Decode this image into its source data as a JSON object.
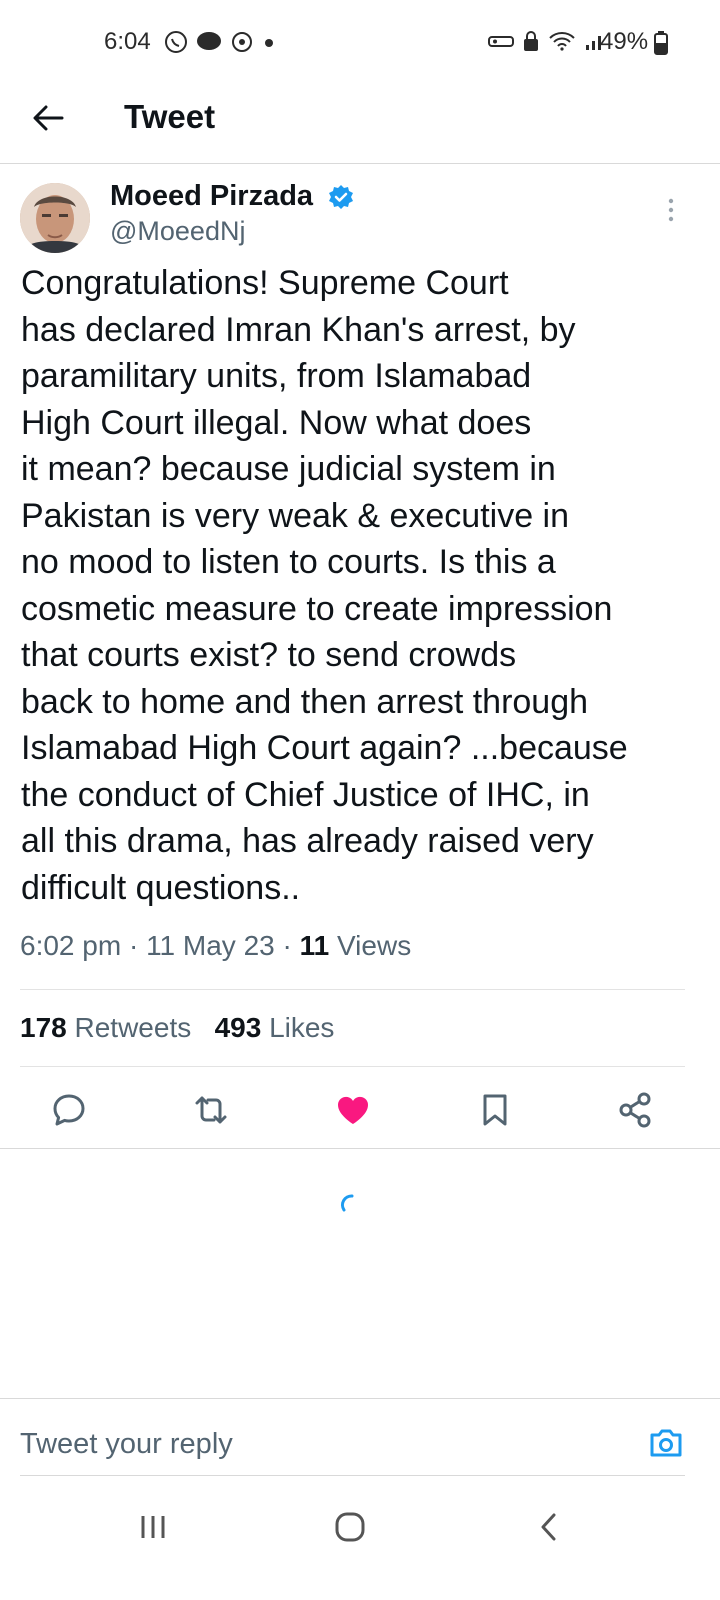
{
  "status_bar": {
    "time": "6:04",
    "battery": "49%",
    "icons_left": [
      "whatsapp-icon",
      "chat-bubble-icon",
      "sync-icon",
      "dot-icon"
    ],
    "icons_right": [
      "key-icon",
      "lock-icon",
      "wifi-icon",
      "signal-icon",
      "battery-icon"
    ]
  },
  "header": {
    "title": "Tweet"
  },
  "tweet": {
    "author_name": "Moeed Pirzada",
    "author_handle": "@MoeedNj",
    "text": "Congratulations! Supreme Court\nhas declared Imran Khan's arrest, by\nparamilitary units, from Islamabad\nHigh Court illegal. Now what does\nit mean? because judicial system in\nPakistan is very weak & executive in\nno mood to listen to courts. Is this a\ncosmetic measure to create impression\nthat courts exist? to send crowds\nback to home and then arrest through\nIslamabad High Court again? ...because\nthe conduct of Chief Justice of IHC, in\nall this drama, has already raised very\ndifficult questions..",
    "time": "6:02 pm",
    "date": "11 May 23",
    "views_count": "11",
    "views_label": "Views",
    "retweets_count": "178",
    "retweets_label": "Retweets",
    "likes_count": "493",
    "likes_label": "Likes"
  },
  "actions": [
    "reply-icon",
    "retweet-icon",
    "like-icon",
    "bookmark-icon",
    "share-icon"
  ],
  "reply": {
    "placeholder": "Tweet your reply"
  },
  "colors": {
    "accent": "#1d9bf0",
    "like": "#f91880",
    "text": "#0f1419",
    "muted": "#536471"
  }
}
